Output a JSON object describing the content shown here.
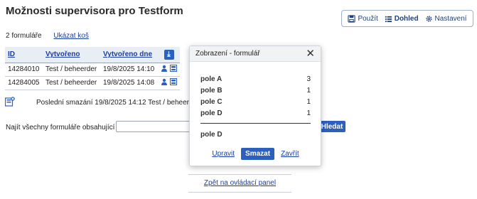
{
  "page": {
    "title": "Možnosti supervisora pro Testform"
  },
  "topnav": {
    "items": [
      {
        "label": "Použít",
        "icon": "save-icon"
      },
      {
        "label": "Dohled",
        "icon": "list-icon",
        "active": true
      },
      {
        "label": "Nastavení",
        "icon": "gear-icon"
      }
    ]
  },
  "summary": {
    "count": "2 formuláře",
    "trash_link": "Ukázat koš"
  },
  "table": {
    "headers": [
      "ID",
      "Vytvořeno",
      "Vytvořeno dne"
    ],
    "rows": [
      {
        "id": "14284010",
        "created_by": "Test / beheerder",
        "created_on": "19/8/2025 14:10"
      },
      {
        "id": "14284005",
        "created_by": "Test / beheerder",
        "created_on": "19/8/2025 14:08"
      }
    ]
  },
  "last_deleted": "Poslední smazání 19/8/2025 14:12 Test / beheerder",
  "search": {
    "label": "Najít všechny formuláře obsahující",
    "value": "",
    "button": "Hledat"
  },
  "back_link": "Zpět na ovládací panel",
  "modal": {
    "title": "Zobrazení - formulář",
    "fields": [
      {
        "name": "pole A",
        "value": "3"
      },
      {
        "name": "pole B",
        "value": "1"
      },
      {
        "name": "pole C",
        "value": "1"
      },
      {
        "name": "pole D",
        "value": "1"
      }
    ],
    "single_field": "pole D",
    "actions": {
      "edit": "Upravit",
      "delete": "Smazat",
      "close": "Zavřít"
    }
  },
  "colors": {
    "accent": "#2b5fc0",
    "link": "#1a3fa0"
  }
}
